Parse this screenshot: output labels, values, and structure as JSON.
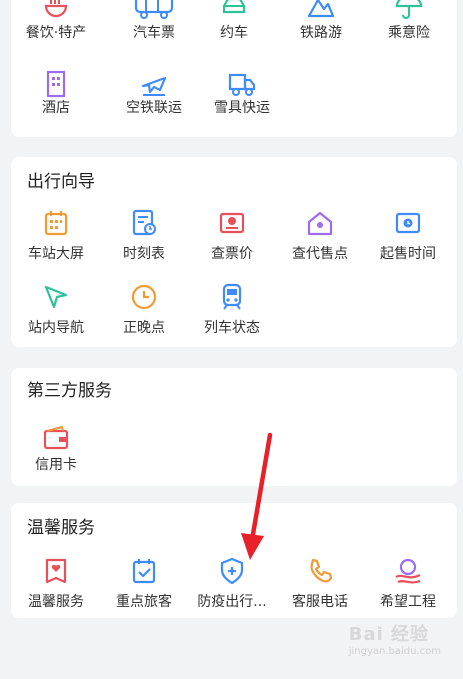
{
  "top": {
    "row1": [
      "餐饮·特产",
      "汽车票",
      "约车",
      "铁路游",
      "乘意险"
    ],
    "row2": [
      "酒店",
      "空铁联运",
      "雪具快运"
    ]
  },
  "guide": {
    "title": "出行向导",
    "row1": [
      "车站大屏",
      "时刻表",
      "查票价",
      "查代售点",
      "起售时间"
    ],
    "row2": [
      "站内导航",
      "正晚点",
      "列车状态"
    ]
  },
  "third": {
    "title": "第三方服务",
    "items": [
      "信用卡"
    ]
  },
  "warm": {
    "title": "温馨服务",
    "items": [
      "温馨服务",
      "重点旅客",
      "防疫出行...",
      "客服电话",
      "希望工程"
    ]
  },
  "watermark": {
    "text": "Bai 经验",
    "sub": "jingyan.baidu.com"
  },
  "colors": {
    "red": "#e8505b",
    "blue": "#3d8bfd",
    "green": "#2fc29a",
    "orange": "#f39a34",
    "purple": "#9b6cf0",
    "accent_arrow": "#e8202a"
  }
}
